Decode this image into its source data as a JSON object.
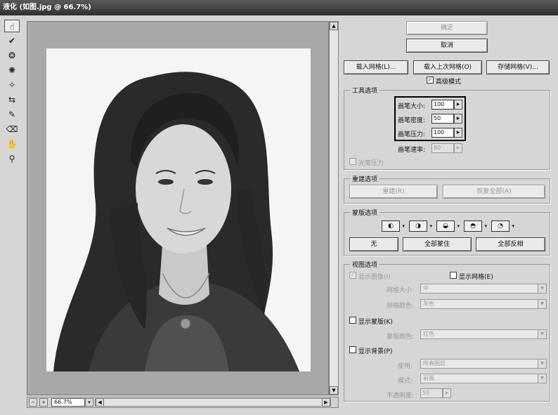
{
  "window": {
    "title": "液化 (如图.jpg @ 66.7%)"
  },
  "toolbar": {
    "tools": [
      {
        "name": "forward-warp-tool",
        "glyph": "☝"
      },
      {
        "name": "reconstruct-tool",
        "glyph": "✔"
      },
      {
        "name": "twirl-tool",
        "glyph": "❂"
      },
      {
        "name": "pucker-tool",
        "glyph": "✺"
      },
      {
        "name": "bloat-tool",
        "glyph": "✧"
      },
      {
        "name": "push-left-tool",
        "glyph": "⇆"
      },
      {
        "name": "freeze-mask-tool",
        "glyph": "✎"
      },
      {
        "name": "thaw-mask-tool",
        "glyph": "⌫"
      },
      {
        "name": "hand-tool",
        "glyph": "✋"
      },
      {
        "name": "zoom-tool",
        "glyph": "⚲"
      }
    ]
  },
  "status": {
    "zoom": "66.7%"
  },
  "actions": {
    "ok": "确定",
    "cancel": "取消",
    "load_mesh": "载入网格(L)...",
    "load_last_mesh": "载入上次网格(O)",
    "save_mesh": "存储网格(V)...",
    "advanced_mode": "高级模式"
  },
  "tool_options": {
    "title": "工具选项",
    "brush_size_label": "画笔大小:",
    "brush_size": "100",
    "brush_density_label": "画笔密度:",
    "brush_density": "50",
    "brush_pressure_label": "画笔压力:",
    "brush_pressure": "100",
    "brush_rate_label": "画笔速率:",
    "brush_rate": "80",
    "stylus_pressure": "光笔压力"
  },
  "reconstruct": {
    "title": "重建选项",
    "reconstruct_button": "重建(R)",
    "restore_all_button": "恢复全部(A)"
  },
  "mask": {
    "title": "蒙版选项",
    "none": "无",
    "mask_all": "全部蒙住",
    "invert_all": "全部反相"
  },
  "view": {
    "title": "视图选项",
    "show_image": "显示图像(I)",
    "show_mesh": "显示网格(E)",
    "mesh_size_label": "网格大小:",
    "mesh_size": "中",
    "mesh_color_label": "网格颜色:",
    "mesh_color": "灰色",
    "show_mask": "显示蒙版(K)",
    "mask_color_label": "蒙版颜色:",
    "mask_color": "红色",
    "show_backdrop": "显示背景(P)",
    "use_label": "使用:",
    "use_value": "所有图层",
    "mode_label": "模式:",
    "mode_value": "前面",
    "opacity_label": "不透明度:",
    "opacity_value": "50"
  }
}
